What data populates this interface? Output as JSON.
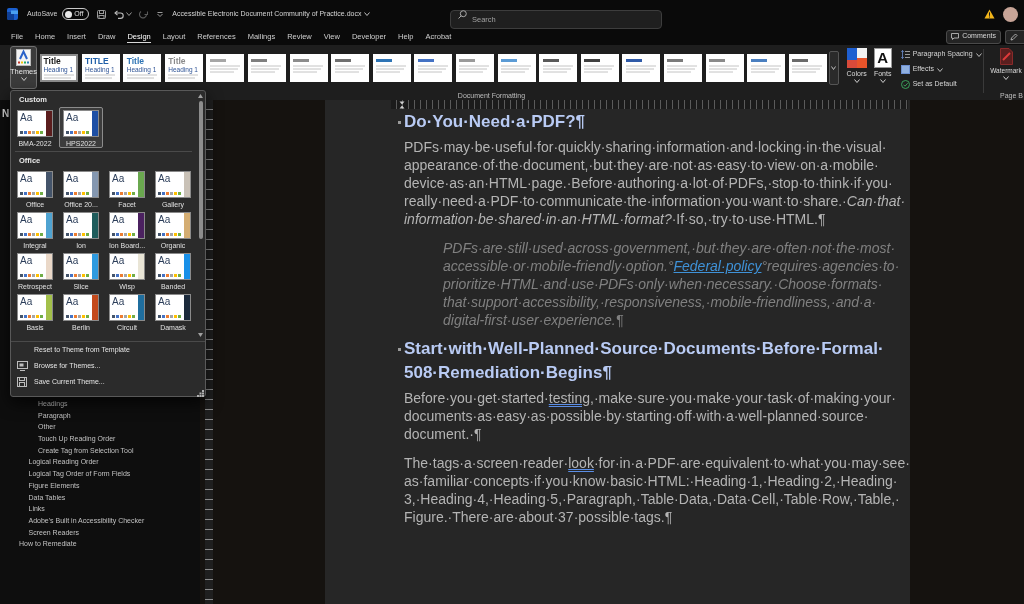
{
  "title_bar": {
    "autosave_label": "AutoSave",
    "autosave": {
      "on": false,
      "label": "Off"
    },
    "document_title": "Accessible Electronic Document Community of Practice.docx",
    "search": {
      "placeholder": "Search"
    }
  },
  "ribbon_tabs": [
    {
      "label": "File",
      "selected": false
    },
    {
      "label": "Home",
      "selected": false
    },
    {
      "label": "Insert",
      "selected": false
    },
    {
      "label": "Draw",
      "selected": false
    },
    {
      "label": "Design",
      "selected": true
    },
    {
      "label": "Layout",
      "selected": false
    },
    {
      "label": "References",
      "selected": false
    },
    {
      "label": "Mailings",
      "selected": false
    },
    {
      "label": "Review",
      "selected": false
    },
    {
      "label": "View",
      "selected": false
    },
    {
      "label": "Developer",
      "selected": false
    },
    {
      "label": "Help",
      "selected": false
    },
    {
      "label": "Acrobat",
      "selected": false
    }
  ],
  "header_buttons": [
    {
      "kind": "comments",
      "label": "Comments"
    },
    {
      "kind": "editing"
    }
  ],
  "ribbon": {
    "themes_button": {
      "label": "Themes",
      "expanded": true
    },
    "style_sets": [
      {
        "title": "Title",
        "heading": "Heading 1",
        "color": "#1a1a1a",
        "selected": true
      },
      {
        "title": "TITLE",
        "heading": "Heading 1",
        "color": "#1f5fa8",
        "selected": false
      },
      {
        "title": "Title",
        "heading": "Heading 1",
        "color": "#2e74b5",
        "selected": false
      },
      {
        "title": "Title",
        "heading": "Heading 1",
        "color": "#8a8a8a",
        "selected": false
      },
      {
        "color": "#a6a6a6",
        "selected": false
      },
      {
        "color": "#7f7f7f",
        "selected": false
      },
      {
        "color": "#8c8c8c",
        "selected": false
      },
      {
        "color": "#6f6f6f",
        "selected": false
      },
      {
        "color": "#2e74b5",
        "selected": false
      },
      {
        "color": "#4472c4",
        "selected": false
      },
      {
        "color": "#9a9a9a",
        "selected": false
      },
      {
        "color": "#5b9bd5",
        "selected": false
      },
      {
        "color": "#595959",
        "selected": false
      },
      {
        "color": "#404040",
        "selected": false
      },
      {
        "color": "#2f5aa8",
        "selected": false
      },
      {
        "color": "#7a7a7a",
        "selected": false
      },
      {
        "color": "#8a8a8a",
        "selected": false
      },
      {
        "color": "#4a7fc0",
        "selected": false
      },
      {
        "color": "#6a6a6a",
        "selected": false
      }
    ],
    "colors_button": {
      "label": "Colors"
    },
    "fonts_button": {
      "label": "Fonts",
      "sample": "A"
    },
    "options": [
      {
        "kind": "paragraph_spacing",
        "label": "Paragraph Spacing",
        "dropdown": true
      },
      {
        "kind": "effects",
        "label": "Effects",
        "dropdown": true
      },
      {
        "kind": "set_default",
        "label": "Set as Default",
        "dropdown": false
      }
    ],
    "group_label": "Document Formatting",
    "watermark_button": {
      "label": "Watermark"
    },
    "page_group_label": "Page B"
  },
  "themes_menu": {
    "sections": [
      {
        "title": "Custom",
        "themes": [
          {
            "label": "BMA-2022",
            "sample": "Aa",
            "color": "#5b1d1d",
            "selected": false
          },
          {
            "label": "HPS2022",
            "sample": "Aa",
            "color": "#1d4fa5",
            "selected": true
          }
        ]
      },
      {
        "title": "Office",
        "themes": [
          {
            "label": "Office",
            "sample": "Aa",
            "color": "#44546a",
            "selected": false
          },
          {
            "label": "Office 20...",
            "sample": "Aa",
            "color": "#8497b0",
            "selected": false
          },
          {
            "label": "Facet",
            "sample": "Aa",
            "color": "#6aa84f",
            "selected": false
          },
          {
            "label": "Gallery",
            "sample": "Aa",
            "color": "#c9c1b6",
            "selected": false
          },
          {
            "label": "Integral",
            "sample": "Aa",
            "color": "#4fa3d1",
            "selected": false
          },
          {
            "label": "Ion",
            "sample": "Aa",
            "color": "#1e5b5b",
            "selected": false
          },
          {
            "label": "Ion Board...",
            "sample": "Aa",
            "color": "#4b2160",
            "selected": false
          },
          {
            "label": "Organic",
            "sample": "Aa",
            "color": "#d4ad72",
            "selected": false
          },
          {
            "label": "Retrospect",
            "sample": "Aa",
            "color": "#ead8c8",
            "selected": false
          },
          {
            "label": "Slice",
            "sample": "Aa",
            "color": "#2f9be0",
            "selected": false
          },
          {
            "label": "Wisp",
            "sample": "Aa",
            "color": "#e9e5d6",
            "selected": false
          },
          {
            "label": "Banded",
            "sample": "Aa",
            "color": "#1890e8",
            "selected": false
          },
          {
            "label": "Basis",
            "sample": "Aa",
            "color": "#a3c04a",
            "selected": false
          },
          {
            "label": "Berlin",
            "sample": "Aa",
            "color": "#c44a1c",
            "selected": false
          },
          {
            "label": "Circuit",
            "sample": "Aa",
            "color": "#1f6e9e",
            "selected": false
          },
          {
            "label": "Damask",
            "sample": "Aa",
            "color": "#1c2a3b",
            "selected": false
          }
        ]
      }
    ],
    "actions": [
      {
        "kind": "reset",
        "label": "Reset to Theme from Template"
      },
      {
        "kind": "browse",
        "label": "Browse for Themes..."
      },
      {
        "kind": "save",
        "label": "Save Current Theme..."
      }
    ]
  },
  "nav_pane": {
    "title": "N",
    "tree": [
      {
        "children": [
          {
            "children": [
              {
                "label": "Headings"
              },
              {
                "label": "Paragraph"
              },
              {
                "label": "Other"
              },
              {
                "label": "Touch Up Reading Order"
              },
              {
                "label": "Create Tag from Selection Tool"
              }
            ]
          },
          {
            "label": "Logical Reading Order"
          },
          {
            "label": "Logical Tag Order of Form Fields"
          },
          {
            "label": "Figure Elements"
          },
          {
            "label": "Data Tables"
          },
          {
            "label": "Links"
          },
          {
            "label": "Adobe's Built in Accessibility Checker"
          },
          {
            "label": "Screen Readers"
          }
        ]
      },
      {
        "label": "How to Remediate"
      }
    ]
  },
  "document": {
    "blocks": [
      {
        "kind": "heading",
        "text": "Do·You·Need·a·PDF?¶"
      },
      {
        "kind": "paragraph",
        "segments": [
          {
            "kind": "text",
            "text": "PDFs·may·be·useful·for·quickly·sharing·information·and·locking·in·the·visual·appearance·of·the·document,·but·they·are·not·as·easy·to·view·on·a·mobile·device·as·an·HTML·page.·Before·authoring·a·lot·of·PDFs,·stop·to·think·if·you·really·need·a·PDF·to·communicate·the·information·you·want·to·share.·*Can·that·information·be·shared·in·an·HTML·format?*·If·so,·try·to·use·HTML.¶"
          }
        ]
      },
      {
        "kind": "quote",
        "segments": [
          {
            "kind": "text",
            "text": "PDFs·are·still·used·across·government,·but·they·are·often·not·the·most·accessible·or·mobile-friendly·option.°"
          },
          {
            "kind": "link",
            "text": "Federal·policy"
          },
          {
            "kind": "text",
            "text": "°requires·agencies·to·prioritize·HTML·and·use·PDFs·only·when·necessary.·Choose·formats·that·support·accessibility,·responsiveness,·mobile-friendliness,·and·a·digital-first·user·experience.¶"
          }
        ]
      },
      {
        "kind": "heading",
        "text": "Start·with·Well-Planned·Source·Documents·Before·Formal·508·Remediation·Begins¶"
      },
      {
        "kind": "paragraph",
        "segments": [
          {
            "kind": "text",
            "text": "Before·you·get·started·"
          },
          {
            "kind": "grammar_flag",
            "text": "testing,"
          },
          {
            "kind": "text",
            "text": "·make·sure·you·make·your·task·of·making·your·documents·as·easy·as·possible·by·starting·off·with·a·well-planned·source·document.·¶"
          }
        ]
      },
      {
        "kind": "paragraph",
        "segments": [
          {
            "kind": "text",
            "text": "The·tags·a·screen·reader·"
          },
          {
            "kind": "grammar_flag",
            "text": "look"
          },
          {
            "kind": "text",
            "text": "·for·in·a·PDF·are·equivalent·to·what·you·may·see·as·familiar·concepts·if·you·know·basic·HTML:·Heading·1,·Heading·2,·Heading·3,·Heading·4,·Heading·5,·Paragraph,·Table·Data,·Data·Cell,·Table·Row,·Table,·Figure.·There·are·about·37·possible·tags.¶"
          }
        ]
      }
    ]
  }
}
